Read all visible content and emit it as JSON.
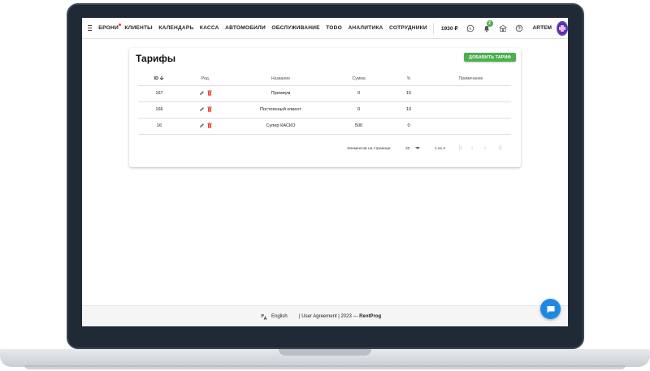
{
  "nav": {
    "items": [
      {
        "label": "БРОНИ",
        "dot": true
      },
      {
        "label": "КЛИЕНТЫ"
      },
      {
        "label": "КАЛЕНДАРЬ"
      },
      {
        "label": "КАССА"
      },
      {
        "label": "АВТОМОБИЛИ"
      },
      {
        "label": "ОБСЛУЖИВАНИЕ"
      },
      {
        "label": "TODO"
      },
      {
        "label": "АНАЛИТИКА"
      },
      {
        "label": "СОТРУДНИКИ"
      }
    ],
    "balance": "1930 ₽",
    "notifications_count": "2",
    "user_name": "ARTEM",
    "icons": [
      "menu-icon",
      "whatsapp-icon",
      "bell-icon",
      "school-icon",
      "help-icon"
    ]
  },
  "page": {
    "title": "Тарифы",
    "add_button": "ДОБАВИТЬ ТАРИФ"
  },
  "table": {
    "headers": {
      "id": "ID",
      "edit": "Ред.",
      "name": "Название",
      "sum": "Сумма",
      "percent": "%",
      "note": "Примечание"
    },
    "rows": [
      {
        "id": "167",
        "name": "Премиум",
        "sum": "0",
        "percent": "15",
        "note": ""
      },
      {
        "id": "166",
        "name": "Постоянный клиент",
        "sum": "0",
        "percent": "10",
        "note": ""
      },
      {
        "id": "16",
        "name": "Супер КАСКО",
        "sum": "500",
        "percent": "0",
        "note": ""
      }
    ]
  },
  "pagination": {
    "per_page_label": "Элементов на странице:",
    "per_page_value": "20",
    "range": "1 из 3"
  },
  "footer": {
    "language": "English",
    "links": "| User Agreement | 2023 — ",
    "brand": "RentProg"
  },
  "colors": {
    "accent_green": "#4caf50",
    "danger_red": "#e53935",
    "chat_blue": "#1e88e5",
    "avatar_purple": "#7b1fa2"
  }
}
